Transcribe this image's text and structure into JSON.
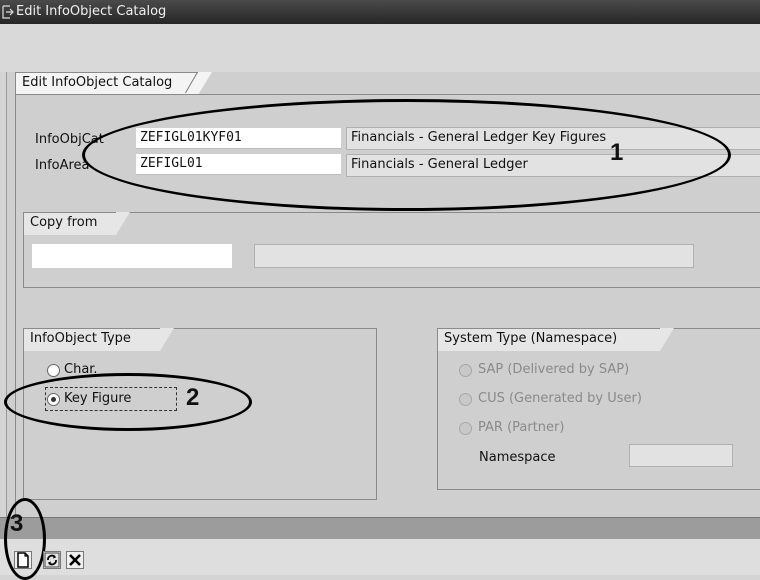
{
  "window": {
    "title": "Edit InfoObject Catalog"
  },
  "main_tab": {
    "label": "Edit InfoObject Catalog"
  },
  "infoobjcat": {
    "label": "InfoObjCat",
    "value": "ZEFIGL01KYF01",
    "description": "Financials - General Ledger Key Figures"
  },
  "infoarea": {
    "label": "InfoArea",
    "value": "ZEFIGL01",
    "description": "Financials - General Ledger"
  },
  "copy_from": {
    "title": "Copy from",
    "value": "",
    "description": ""
  },
  "infoobject_type": {
    "title": "InfoObject Type",
    "options": [
      "Char.",
      "Key Figure"
    ],
    "selected": "Key Figure"
  },
  "system_type": {
    "title": "System Type (Namespace)",
    "options": [
      "SAP (Delivered by SAP)",
      "CUS (Generated by User)",
      "PAR (Partner)"
    ],
    "namespace_label": "Namespace",
    "namespace_value": ""
  },
  "callouts": [
    "1",
    "2",
    "3"
  ],
  "icons": {
    "create": "new-document-icon",
    "refresh": "refresh-icon",
    "cancel": "cancel-icon"
  }
}
